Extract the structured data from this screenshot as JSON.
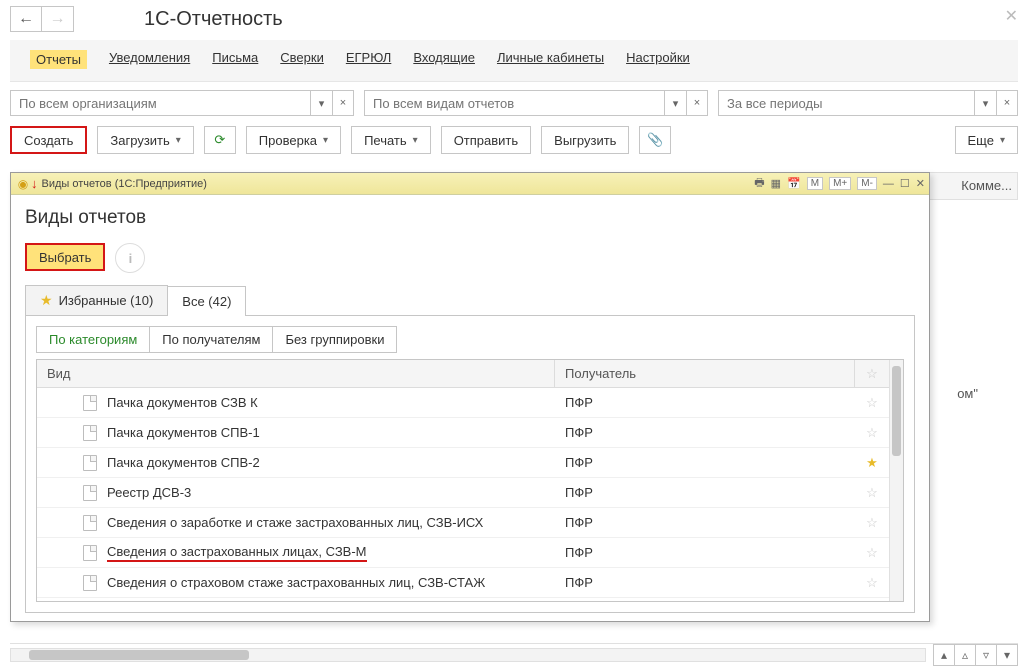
{
  "header": {
    "title": "1С-Отчетность"
  },
  "tabs": [
    {
      "label": "Отчеты",
      "active": true
    },
    {
      "label": "Уведомления"
    },
    {
      "label": "Письма"
    },
    {
      "label": "Сверки"
    },
    {
      "label": "ЕГРЮЛ"
    },
    {
      "label": "Входящие"
    },
    {
      "label": "Личные кабинеты"
    },
    {
      "label": "Настройки"
    }
  ],
  "filters": {
    "org_placeholder": "По всем организациям",
    "types_placeholder": "По всем видам отчетов",
    "periods_placeholder": "За все периоды"
  },
  "toolbar": {
    "create": "Создать",
    "load": "Загрузить",
    "check": "Проверка",
    "print": "Печать",
    "send": "Отправить",
    "unload": "Выгрузить",
    "more": "Еще"
  },
  "columns": {
    "comments": "Комме..."
  },
  "bg_snippet": "ом\"",
  "modal": {
    "window_title": "Виды отчетов  (1С:Предприятие)",
    "heading": "Виды отчетов",
    "select": "Выбрать",
    "icons": {
      "m": "M",
      "m_plus": "M+",
      "m_minus": "M-"
    },
    "fav_tab": "Избранные (10)",
    "all_tab": "Все (42)",
    "group_tabs": {
      "by_category": "По категориям",
      "by_recipient": "По получателям",
      "no_group": "Без группировки"
    },
    "grid_headers": {
      "kind": "Вид",
      "recipient": "Получатель"
    },
    "rows": [
      {
        "name": "Пачка документов СЗВ К",
        "recipient": "ПФР",
        "fav": false,
        "hl": false
      },
      {
        "name": "Пачка документов СПВ-1",
        "recipient": "ПФР",
        "fav": false,
        "hl": false
      },
      {
        "name": "Пачка документов СПВ-2",
        "recipient": "ПФР",
        "fav": true,
        "hl": false
      },
      {
        "name": "Реестр ДСВ-3",
        "recipient": "ПФР",
        "fav": false,
        "hl": false
      },
      {
        "name": "Сведения о заработке и стаже застрахованных лиц, СЗВ-ИСХ",
        "recipient": "ПФР",
        "fav": false,
        "hl": false
      },
      {
        "name": "Сведения о застрахованных лицах, СЗВ-М",
        "recipient": "ПФР",
        "fav": false,
        "hl": true
      },
      {
        "name": "Сведения о страховом стаже застрахованных лиц, СЗВ-СТАЖ",
        "recipient": "ПФР",
        "fav": false,
        "hl": false
      }
    ]
  }
}
